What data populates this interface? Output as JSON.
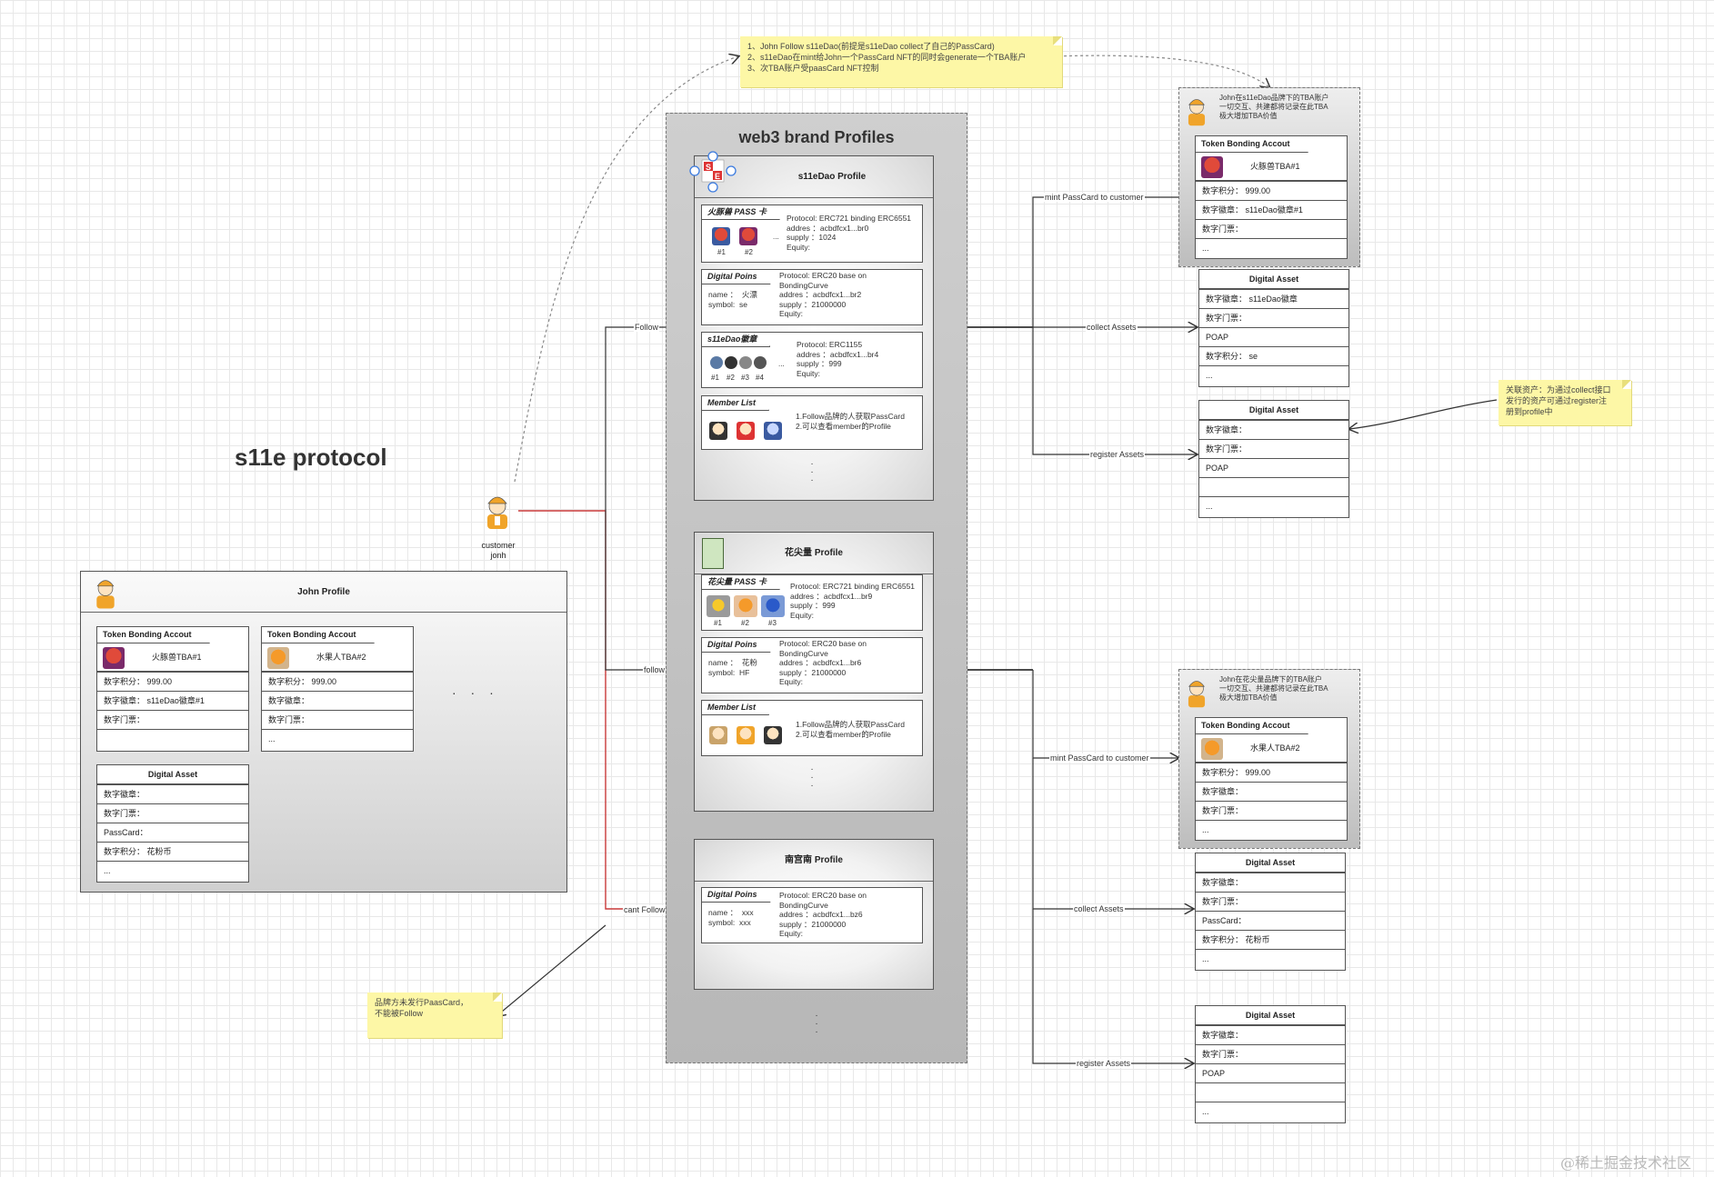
{
  "diagram_title": "s11e protocol",
  "brand_container_title": "web3 brand Profiles",
  "top_note": [
    "1、John Follow s11eDao(前提是s11eDao collect了自己的PassCard)",
    "2、s11eDao在mint给John一个PassCard NFT的同时会generate一个TBA账户",
    "3、次TBA账户受paasCard NFT控制"
  ],
  "right_note": [
    "关联资产：为通过collect接口",
    "发行的资产可通过register注",
    "册到profile中"
  ],
  "bottom_note": [
    "品牌方未发行PaasCard，",
    "不能被Follow"
  ],
  "customer": {
    "label_line1": "customer",
    "label_line2": "jonh"
  },
  "john_profile": {
    "title": "John Profile",
    "tba1": {
      "tab": "Token Bonding Accout",
      "name": "火豚兽TBA#1",
      "rows": [
        "数字积分：  999.00",
        "数字徽章：  s11eDao徽章#1",
        "数字门票：",
        ""
      ]
    },
    "tba2": {
      "tab": "Token Bonding Accout",
      "name": "水果人TBA#2",
      "rows": [
        "数字积分：  999.00",
        "数字徽章：",
        "数字门票：",
        "..."
      ]
    },
    "more": "· · ·",
    "asset": {
      "title": "Digital Asset",
      "rows": [
        "数字徽章：",
        "数字门票：",
        "PassCard：",
        "数字积分：  花粉币",
        "..."
      ]
    }
  },
  "s11e_profile": {
    "title": "s11eDao Profile",
    "pass": {
      "tab": "火豚兽 PASS 卡",
      "info": "Protocol: ERC721 binding ERC6551\naddres ：acbdfcx1...br0\nsupply ：1024\nEquity:",
      "labels": [
        "#1",
        "#2"
      ],
      "ellipsis": "..."
    },
    "points": {
      "tab": "Digital Poins",
      "left": "name ：  火漂\nsymbol:  se",
      "info": "Protocol: ERC20 base on\nBondingCurve\naddres ：acbdfcx1...br2\nsupply ：21000000\nEquity:"
    },
    "badge": {
      "tab": "s11eDao徽章",
      "info": "Protocol: ERC1155\naddres ：acbdfcx1...br4\nsupply ：999\nEquity:",
      "labels": [
        "#1",
        "#2",
        "#3",
        "#4"
      ],
      "ellipsis": "..."
    },
    "members": {
      "tab": "Member List",
      "info": "1.Follow品牌的人获取PassCard\n2.可以查看member的Profile"
    }
  },
  "huajian_profile": {
    "title": "花尖量 Profile",
    "pass": {
      "tab": "花尖量 PASS 卡",
      "info": "Protocol: ERC721 binding ERC6551\naddres ：acbdfcx1...br9\nsupply ：999\nEquity:",
      "labels": [
        "#1",
        "#2",
        "#3"
      ]
    },
    "points": {
      "tab": "Digital Poins",
      "left": "name ：  花粉\nsymbol:  HF",
      "info": "Protocol: ERC20 base on\nBondingCurve\naddres ：acbdfcx1...br6\nsupply ：21000000\nEquity:"
    },
    "members": {
      "tab": "Member List",
      "info": "1.Follow品牌的人获取PassCard\n2.可以查看member的Profile"
    }
  },
  "nangong_profile": {
    "title": "南宫南 Profile",
    "points": {
      "tab": "Digital Poins",
      "left": "name ：  xxx\nsymbol:  xxx",
      "info": "Protocol: ERC20 base on\nBondingCurve\naddres ：acbdfcx1...bz6\nsupply ：21000000\nEquity:"
    }
  },
  "edge_labels": {
    "follow1": "Follow",
    "follow2": "follow",
    "cant_follow": "cant Follow",
    "mint1": "mint PassCard to customer",
    "collect1": "collect Assets",
    "register1": "register Assets",
    "mint2": "mint PassCard to customer",
    "collect2": "collect Assets",
    "register2": "register Assets"
  },
  "right_top_group": {
    "caption": "John在s11eDao品牌下的TBA账户\n一切交互、共建都将记录在此TBA\n极大增加TBA价值",
    "tab": "Token Bonding Accout",
    "name": "火豚兽TBA#1",
    "rows": [
      "数字积分：  999.00",
      "数字徽章：  s11eDao徽章#1",
      "数字门票：",
      "..."
    ]
  },
  "right_asset1": {
    "title": "Digital Asset",
    "rows": [
      "数字徽章：  s11eDao徽章",
      "数字门票：",
      "POAP",
      "数字积分：  se",
      "..."
    ]
  },
  "right_asset2": {
    "title": "Digital Asset",
    "rows": [
      "数字徽章：",
      "数字门票：",
      "POAP",
      "",
      "..."
    ]
  },
  "right_bottom_group": {
    "caption": "John在花尖量品牌下的TBA账户\n一切交互、共建都将记录在此TBA\n极大增加TBA价值",
    "tab": "Token Bonding Accout",
    "name": "水果人TBA#2",
    "rows": [
      "数字积分：  999.00",
      "数字徽章：",
      "数字门票：",
      "..."
    ]
  },
  "right_asset3": {
    "title": "Digital Asset",
    "rows": [
      "数字徽章：",
      "数字门票：",
      "PassCard：",
      "数字积分：  花粉币",
      "..."
    ]
  },
  "right_asset4": {
    "title": "Digital Asset",
    "rows": [
      "数字徽章：",
      "数字门票：",
      "POAP",
      "",
      "..."
    ]
  },
  "watermark": "@稀土掘金技术社区",
  "colors": {
    "red_line": "#c93a3a",
    "dark_line": "#333333",
    "note_yellow": "#fdf7a6",
    "avatar_orange": "#f0a42a"
  }
}
